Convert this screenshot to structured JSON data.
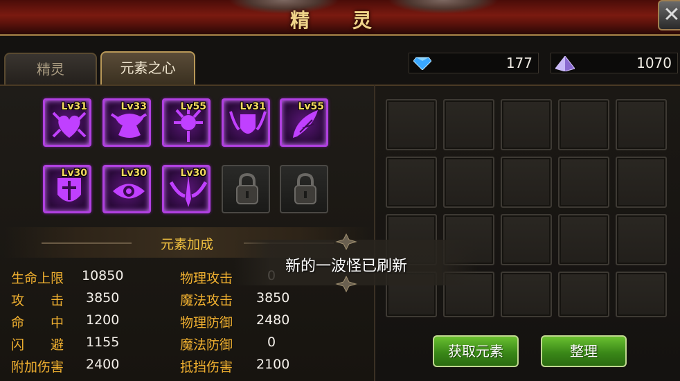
{
  "window": {
    "title": "精 灵"
  },
  "tabs": [
    {
      "label": "精灵",
      "active": false
    },
    {
      "label": "元素之心",
      "active": true
    }
  ],
  "currency": [
    {
      "icon": "blue-diamond-icon",
      "value": "177"
    },
    {
      "icon": "purple-crystal-icon",
      "value": "1070"
    }
  ],
  "elements": [
    {
      "icon": "heart-sigil-icon",
      "level": "Lv31",
      "locked": false
    },
    {
      "icon": "winged-helm-icon",
      "level": "Lv33",
      "locked": false
    },
    {
      "icon": "spiked-orb-icon",
      "level": "Lv55",
      "locked": false
    },
    {
      "icon": "winged-shield-icon",
      "level": "Lv31",
      "locked": false
    },
    {
      "icon": "feather-wing-icon",
      "level": "Lv55",
      "locked": false
    },
    {
      "icon": "cross-shield-icon",
      "level": "Lv30",
      "locked": false
    },
    {
      "icon": "eye-sigil-icon",
      "level": "Lv30",
      "locked": false
    },
    {
      "icon": "winged-sword-icon",
      "level": "Lv30",
      "locked": false
    },
    {
      "icon": "padlock-icon",
      "level": "",
      "locked": true
    },
    {
      "icon": "padlock-icon",
      "level": "",
      "locked": true
    }
  ],
  "bonus": {
    "title": "元素加成",
    "left": [
      {
        "label": "生命上限",
        "value": "10850"
      },
      {
        "label": "攻　　击",
        "value": "3850"
      },
      {
        "label": "命　　中",
        "value": "1200"
      },
      {
        "label": "闪　　避",
        "value": "1155"
      },
      {
        "label": "附加伤害",
        "value": "2400"
      }
    ],
    "right": [
      {
        "label": "物理攻击",
        "value": "0"
      },
      {
        "label": "魔法攻击",
        "value": "3850"
      },
      {
        "label": "物理防御",
        "value": "2480"
      },
      {
        "label": "魔法防御",
        "value": "0"
      },
      {
        "label": "抵挡伤害",
        "value": "2100"
      }
    ]
  },
  "inventory": {
    "rows": 4,
    "cols": 5
  },
  "buttons": {
    "obtain": "获取元素",
    "sort": "整理"
  },
  "toast": {
    "message": "新的一波怪已刷新"
  },
  "colors": {
    "accent_gold": "#f0c040",
    "element_border": "#b040e0",
    "button_green": "#3a8818"
  }
}
